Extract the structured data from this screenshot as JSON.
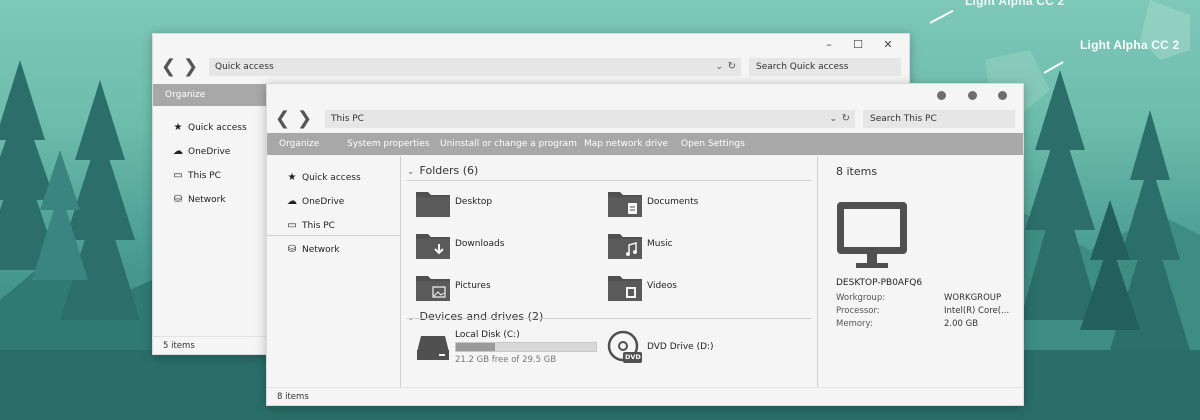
{
  "brand": {
    "primary": "Light Alpha CC 2",
    "secondary": "Light Alpha CC 2"
  },
  "back_window": {
    "address": "Quick access",
    "search_placeholder": "Search Quick access",
    "organize": "Organize",
    "nav": [
      "Quick access",
      "OneDrive",
      "This PC",
      "Network"
    ],
    "status": "5 items",
    "controls": {
      "minimize": "–",
      "maximize": "☐",
      "close": "✕"
    }
  },
  "front_window": {
    "address": "This PC",
    "search_placeholder": "Search This PC",
    "commands": [
      "Organize",
      "System properties",
      "Uninstall or change a program",
      "Map network drive",
      "Open Settings"
    ],
    "nav": [
      "Quick access",
      "OneDrive",
      "This PC",
      "Network"
    ],
    "folders_header": "Folders (6)",
    "folders": [
      "Desktop",
      "Documents",
      "Downloads",
      "Music",
      "Pictures",
      "Videos"
    ],
    "drives_header": "Devices and drives (2)",
    "local_disk": {
      "name": "Local Disk (C:)",
      "free": "21.2 GB free of 29.5 GB",
      "used_fraction": 0.28
    },
    "dvd_drive": {
      "name": "DVD Drive (D:)",
      "badge": "DVD"
    },
    "details": {
      "count": "8 items",
      "pc_name": "DESKTOP-PB0AFQ6",
      "workgroup_label": "Workgroup:",
      "workgroup": "WORKGROUP",
      "processor_label": "Processor:",
      "processor": "Intel(R) Core(...",
      "memory_label": "Memory:",
      "memory": "2.00 GB"
    },
    "status": "8 items"
  },
  "colors": {
    "cmdbar": "#a8a8a8",
    "accent_icon": "#505050"
  }
}
